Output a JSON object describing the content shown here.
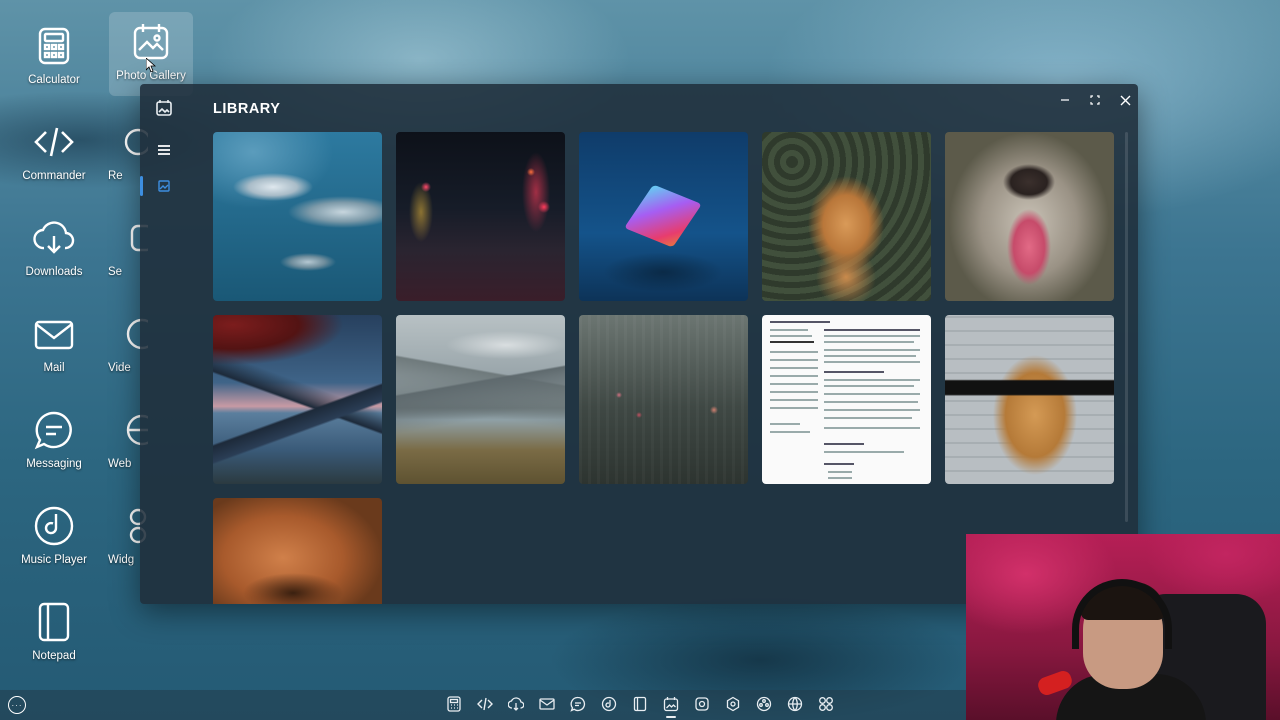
{
  "desktop": {
    "icons": [
      {
        "label": "Calculator",
        "icon": "calculator-icon"
      },
      {
        "label": "Photo Gallery",
        "icon": "photo-gallery-icon"
      },
      {
        "label": "Commander",
        "icon": "code-icon"
      },
      {
        "label": "Re",
        "icon": "recorder-icon"
      },
      {
        "label": "Downloads",
        "icon": "download-cloud-icon"
      },
      {
        "label": "Se",
        "icon": "settings-icon"
      },
      {
        "label": "Mail",
        "icon": "mail-icon"
      },
      {
        "label": "Vide",
        "icon": "video-icon"
      },
      {
        "label": "Messaging",
        "icon": "chat-icon"
      },
      {
        "label": "Web",
        "icon": "web-icon"
      },
      {
        "label": "Music Player",
        "icon": "music-icon"
      },
      {
        "label": "Widg",
        "icon": "widgets-icon"
      },
      {
        "label": "Notepad",
        "icon": "notepad-icon"
      }
    ]
  },
  "window": {
    "title": "LIBRARY",
    "controls": [
      "minimize-icon",
      "maximize-icon",
      "close-icon"
    ],
    "sidebar": [
      "photo-gallery-icon",
      "hamburger-menu-icon",
      "image-library-icon"
    ],
    "photos": [
      {
        "subject": "dolphins"
      },
      {
        "subject": "neon-street"
      },
      {
        "subject": "glowing-cube"
      },
      {
        "subject": "golden-retriever"
      },
      {
        "subject": "husky-tongue"
      },
      {
        "subject": "mount-fuji"
      },
      {
        "subject": "mountain-lake"
      },
      {
        "subject": "rainy-window"
      },
      {
        "subject": "resume-document"
      },
      {
        "subject": "dog-sunglasses"
      },
      {
        "subject": "shiba-closeup"
      }
    ]
  },
  "taskbar": {
    "icons": [
      "calculator-icon",
      "code-icon",
      "download-cloud-icon",
      "mail-icon",
      "chat-icon",
      "music-icon",
      "notepad-icon",
      "photo-gallery-icon",
      "recorder-icon",
      "settings-icon",
      "video-icon",
      "web-icon",
      "widgets-icon"
    ],
    "active": "photo-gallery-icon"
  },
  "colors": {
    "accent": "#3d8ee0",
    "icon": "#e9eef2",
    "window_bg": "#1f2e3a"
  }
}
